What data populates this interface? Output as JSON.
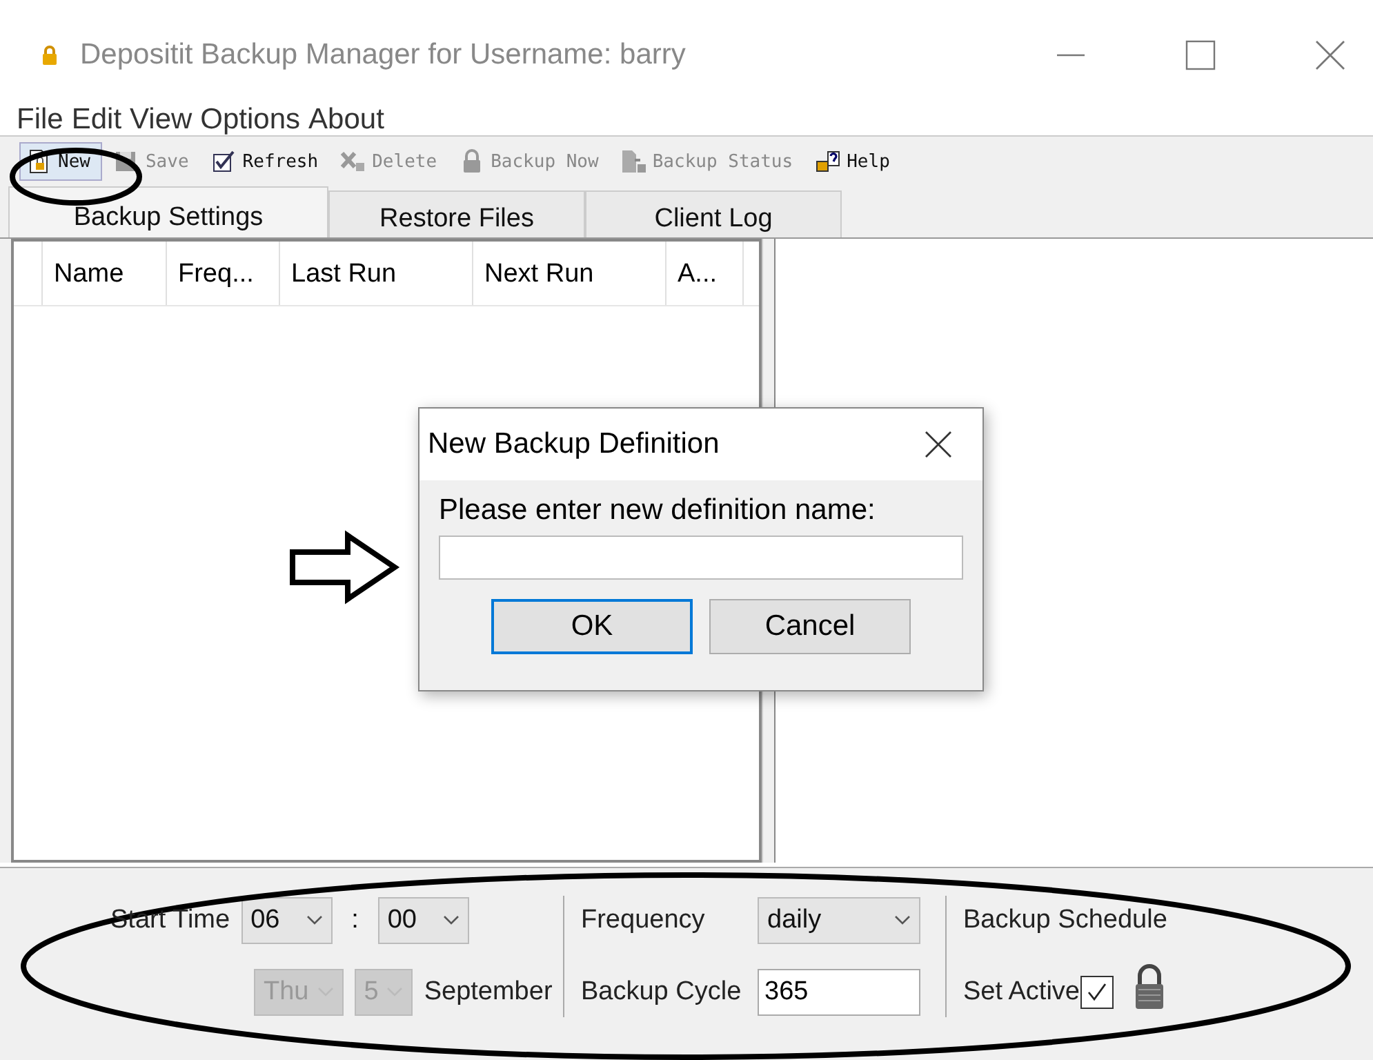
{
  "window": {
    "title": "Depositit Backup Manager for Username: barry"
  },
  "menu": [
    "File",
    "Edit",
    "View",
    "Options",
    "About"
  ],
  "toolbar": [
    {
      "label": "New",
      "disabled": false
    },
    {
      "label": "Save",
      "disabled": true
    },
    {
      "label": "Refresh",
      "disabled": false
    },
    {
      "label": "Delete",
      "disabled": true
    },
    {
      "label": "Backup Now",
      "disabled": true
    },
    {
      "label": "Backup Status",
      "disabled": true
    },
    {
      "label": "Help",
      "disabled": false
    }
  ],
  "tabs": [
    {
      "label": "Backup Settings",
      "selected": true
    },
    {
      "label": "Restore Files",
      "selected": false
    },
    {
      "label": "Client Log",
      "selected": false
    }
  ],
  "table": {
    "columns": [
      "Name",
      "Freq...",
      "Last Run",
      "Next Run",
      "A..."
    ]
  },
  "schedule": {
    "start_time_label": "Start Time",
    "hour": {
      "value": "06",
      "disabled": false
    },
    "separator": ":",
    "minute": {
      "value": "00",
      "disabled": false
    },
    "day": {
      "value": "Thu",
      "disabled": true
    },
    "date": {
      "value": "5",
      "disabled": true
    },
    "month": "September",
    "frequency_label": "Frequency",
    "frequency": "daily",
    "cycle_label": "Backup Cycle",
    "cycle": "365",
    "schedule_label": "Backup Schedule",
    "active_label": "Set Active",
    "active": true
  },
  "dialog": {
    "title": "New Backup Definition",
    "prompt": "Please enter new definition name:",
    "buttons": [
      {
        "label": "OK",
        "selected": true
      },
      {
        "label": "Cancel",
        "selected": false
      }
    ]
  }
}
